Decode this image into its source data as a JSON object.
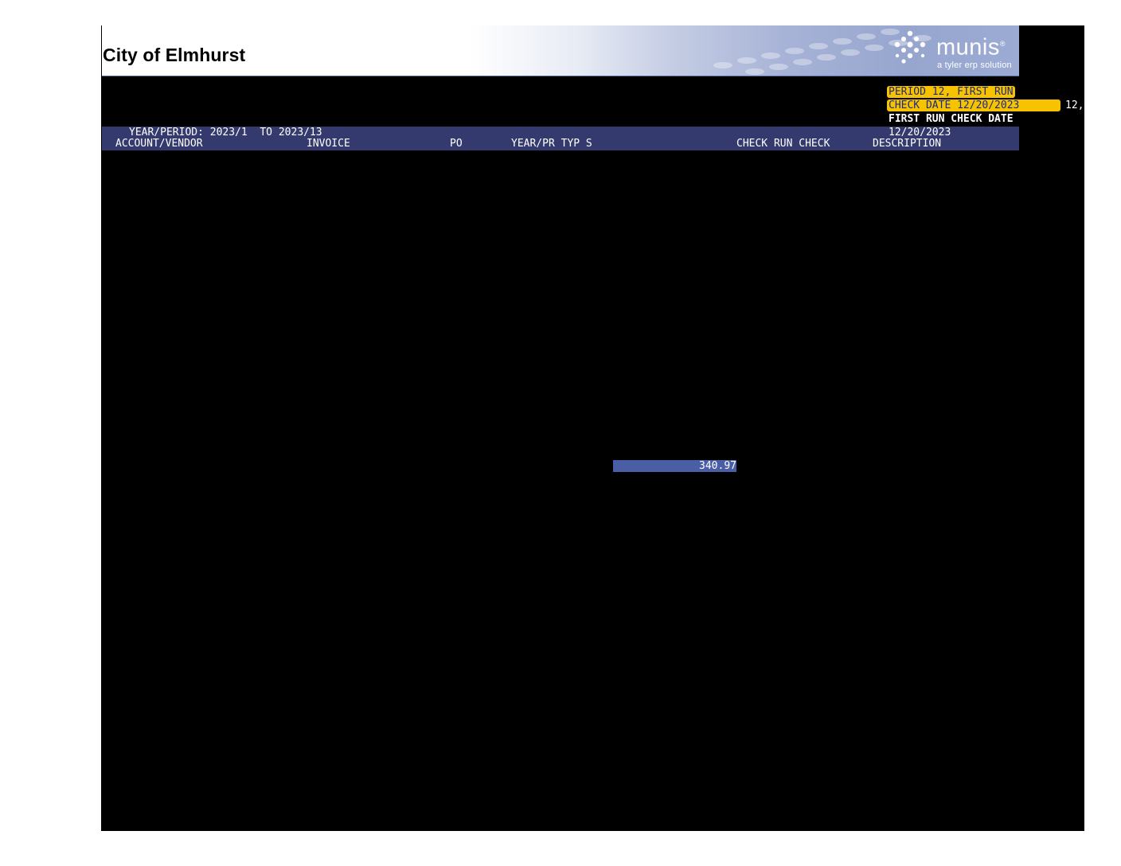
{
  "banner": {
    "org_name": "City of Elmhurst",
    "logo_text": "munis",
    "logo_registered": "®",
    "logo_tagline": "a tyler erp solution"
  },
  "run_info": {
    "period_label": "PERIOD 12, FIRST RUN",
    "check_date_label": "CHECK DATE 12/20/2023",
    "overflow_text": "12,",
    "first_run_label": "FIRST RUN CHECK DATE",
    "first_run_date": "12/20/2023"
  },
  "header": {
    "year_period": "YEAR/PERIOD: 2023/1  TO 2023/13",
    "columns": {
      "account_vendor": "ACCOUNT/VENDOR",
      "invoice": "INVOICE",
      "po": "PO",
      "year_pr_typ_s": "YEAR/PR TYP S",
      "check_run_check": "CHECK RUN CHECK",
      "description": "DESCRIPTION"
    }
  },
  "body": {
    "total_amount": "340.97"
  },
  "colors": {
    "banner_blue": "#97a6cf",
    "header_bar": "#343a6e",
    "highlight_yellow": "#f7c300",
    "total_cell": "#4a5ea6"
  }
}
